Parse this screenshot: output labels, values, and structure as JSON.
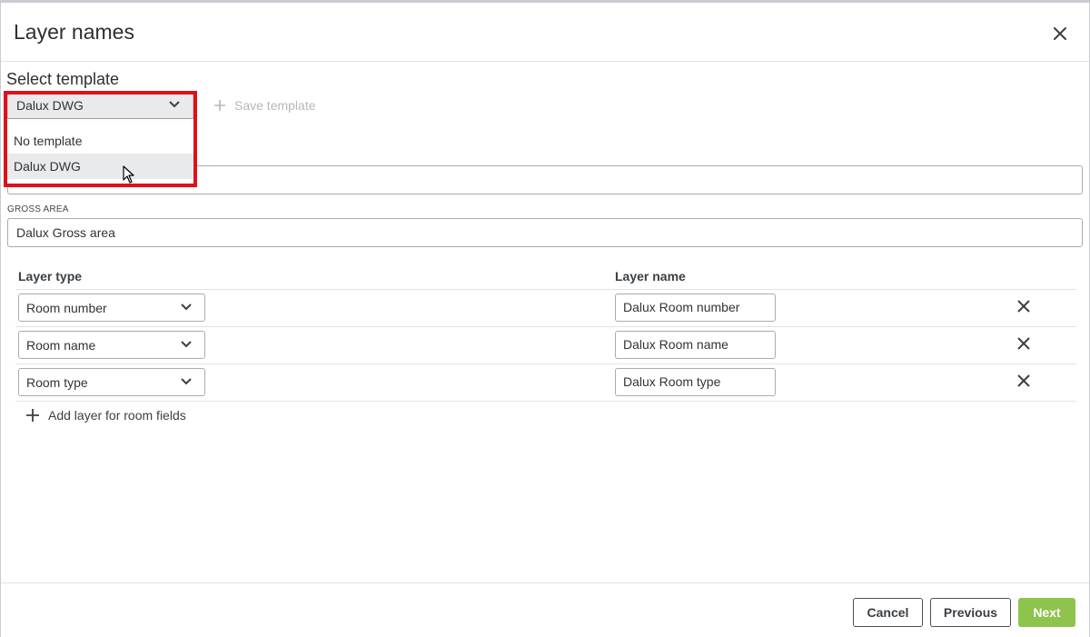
{
  "dialog": {
    "title": "Layer names"
  },
  "template": {
    "section_label": "Select template",
    "selected": "Dalux DWG",
    "options": [
      "No template",
      "Dalux DWG"
    ],
    "hover_index": 1,
    "save_label": "Save template"
  },
  "fields": {
    "gross_area_label": "GROSS AREA",
    "gross_area_value": "Dalux Gross area"
  },
  "table": {
    "col_type": "Layer type",
    "col_name": "Layer name",
    "rows": [
      {
        "type": "Room number",
        "name": "Dalux Room number"
      },
      {
        "type": "Room name",
        "name": "Dalux Room name"
      },
      {
        "type": "Room type",
        "name": "Dalux Room type"
      }
    ],
    "add_label": "Add layer for room fields"
  },
  "footer": {
    "cancel": "Cancel",
    "previous": "Previous",
    "next": "Next"
  },
  "colors": {
    "highlight": "#e0101a",
    "primary": "#8ec34c"
  }
}
